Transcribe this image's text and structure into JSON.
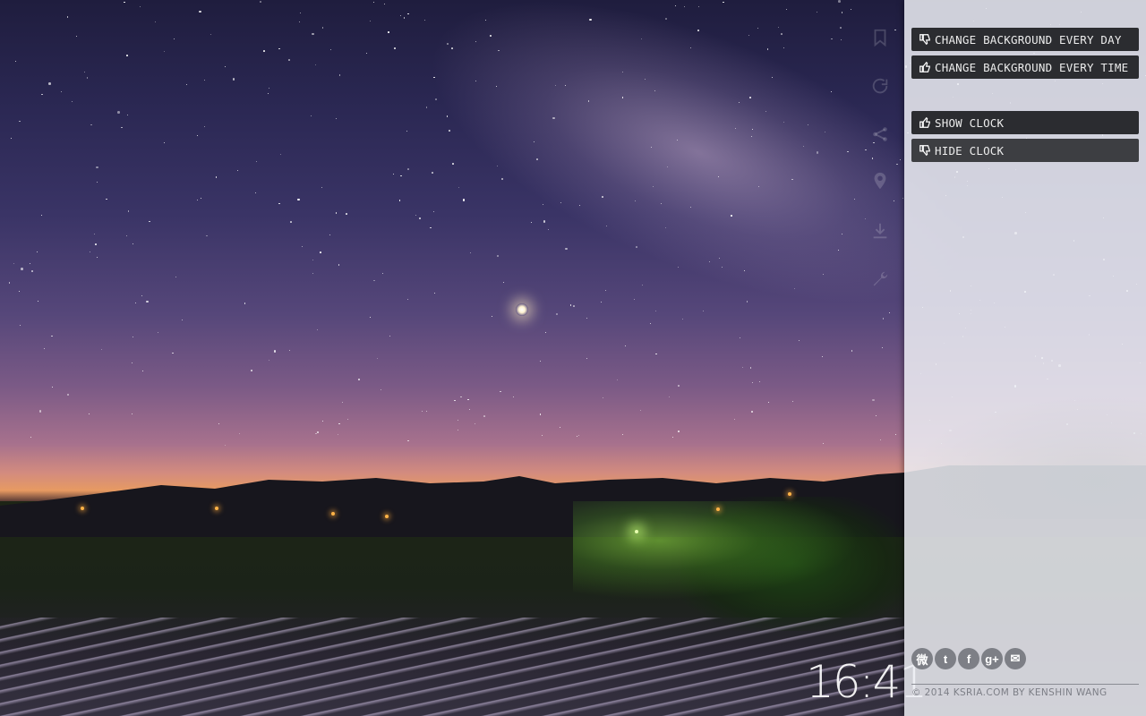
{
  "toolbar": {
    "items": [
      {
        "icon": "bookmark-icon"
      },
      {
        "icon": "refresh-icon"
      },
      {
        "icon": "share-icon"
      },
      {
        "icon": "location-icon"
      },
      {
        "icon": "download-icon"
      },
      {
        "icon": "settings-icon"
      }
    ]
  },
  "clock": {
    "time": "16:41"
  },
  "settings": {
    "background_options": [
      {
        "label": "CHANGE BACKGROUND EVERY DAY",
        "icon": "thumbs-down-icon",
        "selected": false
      },
      {
        "label": "CHANGE BACKGROUND EVERY TIME",
        "icon": "thumbs-up-icon",
        "selected": true
      }
    ],
    "clock_options": [
      {
        "label": "SHOW CLOCK",
        "icon": "thumbs-up-icon",
        "selected": true
      },
      {
        "label": "HIDE CLOCK",
        "icon": "thumbs-down-icon",
        "selected": false
      }
    ]
  },
  "social": [
    {
      "name": "weibo-icon",
      "glyph": "微"
    },
    {
      "name": "twitter-icon",
      "glyph": "t"
    },
    {
      "name": "facebook-icon",
      "glyph": "f"
    },
    {
      "name": "google-plus-icon",
      "glyph": "g+"
    },
    {
      "name": "email-icon",
      "glyph": "✉"
    }
  ],
  "footer": {
    "text": "© 2014 KSRIA.COM BY KENSHIN WANG"
  },
  "colors": {
    "panel": "#eceef3",
    "option_bg": "#2b2c30",
    "option_text": "#ececec"
  }
}
